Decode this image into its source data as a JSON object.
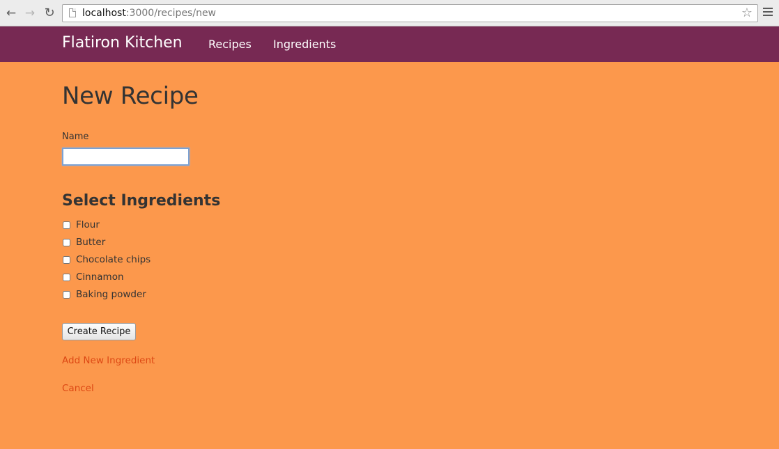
{
  "browser": {
    "url_host": "localhost",
    "url_path": ":3000/recipes/new",
    "icons": [
      "back-arrow-icon",
      "forward-arrow-icon",
      "reload-icon",
      "page-icon",
      "bookmark-star-icon",
      "menu-icon"
    ]
  },
  "navbar": {
    "brand": "Flatiron Kitchen",
    "links": [
      "Recipes",
      "Ingredients"
    ],
    "background": "#772953"
  },
  "page": {
    "background": "#fc984c",
    "title": "New Recipe",
    "name_label": "Name",
    "name_value": "",
    "section_title": "Select Ingredients",
    "ingredients": [
      {
        "label": "Flour",
        "checked": false
      },
      {
        "label": "Butter",
        "checked": false
      },
      {
        "label": "Chocolate chips",
        "checked": false
      },
      {
        "label": "Cinnamon",
        "checked": false
      },
      {
        "label": "Baking powder",
        "checked": false
      }
    ],
    "submit_label": "Create Recipe",
    "add_ingredient_link": "Add New Ingredient",
    "cancel_link": "Cancel",
    "link_color": "#dd4814"
  }
}
